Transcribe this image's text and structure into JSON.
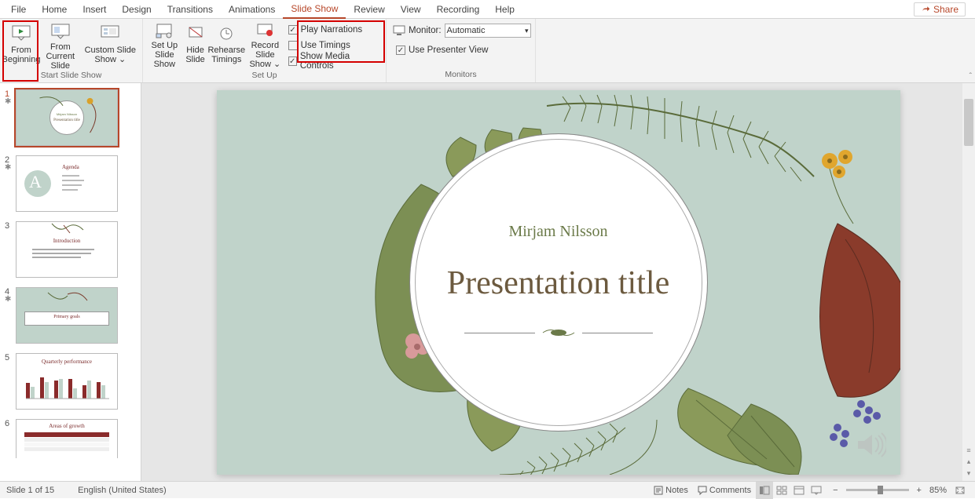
{
  "tabs": {
    "file": "File",
    "home": "Home",
    "insert": "Insert",
    "design": "Design",
    "transitions": "Transitions",
    "animations": "Animations",
    "slide_show": "Slide Show",
    "review": "Review",
    "view": "View",
    "recording": "Recording",
    "help": "Help"
  },
  "share_label": "Share",
  "ribbon": {
    "start": {
      "from_beginning": "From Beginning",
      "from_current": "From Current Slide",
      "custom": "Custom Slide Show ⌄",
      "group_label": "Start Slide Show"
    },
    "setup": {
      "setup": "Set Up Slide Show",
      "hide": "Hide Slide",
      "rehearse": "Rehearse Timings",
      "record": "Record Slide Show ⌄",
      "play_narrations": "Play Narrations",
      "use_timings": "Use Timings",
      "show_media": "Show Media Controls",
      "group_label": "Set Up"
    },
    "monitors": {
      "monitor_label": "Monitor:",
      "monitor_value": "Automatic",
      "presenter_view": "Use Presenter View",
      "group_label": "Monitors"
    }
  },
  "thumbs": [
    {
      "num": "1",
      "star": true,
      "kind": "title",
      "line1": "Mirjam Nilsson",
      "line2": "Presentation title"
    },
    {
      "num": "2",
      "star": true,
      "kind": "agenda",
      "header": "Agenda"
    },
    {
      "num": "3",
      "star": false,
      "kind": "intro",
      "header": "Introduction"
    },
    {
      "num": "4",
      "star": true,
      "kind": "goals",
      "header": "Primary goals"
    },
    {
      "num": "5",
      "star": false,
      "kind": "chart",
      "header": "Quarterly performance"
    },
    {
      "num": "6",
      "star": false,
      "kind": "table",
      "header": "Areas of growth"
    }
  ],
  "slide": {
    "author": "Mirjam Nilsson",
    "title": "Presentation title"
  },
  "status": {
    "slide_info": "Slide 1 of 15",
    "language": "English (United States)",
    "notes": "Notes",
    "comments": "Comments",
    "zoom": "85%"
  }
}
